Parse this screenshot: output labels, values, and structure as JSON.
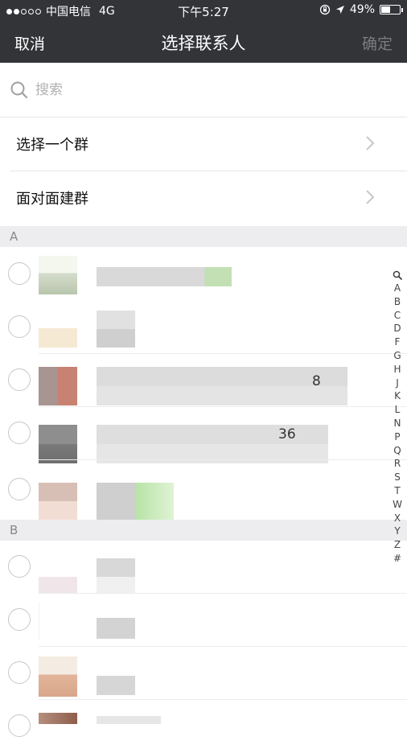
{
  "status_bar": {
    "carrier": "中国电信",
    "network": "4G",
    "time": "下午5:27",
    "battery": "49%",
    "battery_level": 0.49,
    "signal_bars_filled": 2
  },
  "nav": {
    "cancel_label": "取消",
    "title": "选择联系人",
    "confirm_label": "确定"
  },
  "search": {
    "placeholder": "搜索"
  },
  "menu": [
    {
      "label": "选择一个群"
    },
    {
      "label": "面对面建群"
    }
  ],
  "sections": [
    {
      "letter": "A"
    },
    {
      "letter": "B"
    }
  ],
  "contact_tails": {
    "a3": "8",
    "a4": "36"
  },
  "index_letters": [
    "A",
    "B",
    "C",
    "D",
    "F",
    "G",
    "H",
    "J",
    "K",
    "L",
    "N",
    "P",
    "Q",
    "R",
    "S",
    "T",
    "W",
    "X",
    "Y",
    "Z",
    "#"
  ],
  "colors": {
    "nav_background": "#333438",
    "section_background": "#ededf0",
    "confirm_disabled": "#7b7c80"
  },
  "icons": {
    "search": "magnifier",
    "chevron": "chevron-right",
    "location": "location-arrow",
    "lock_rotation": "rotation-lock"
  }
}
